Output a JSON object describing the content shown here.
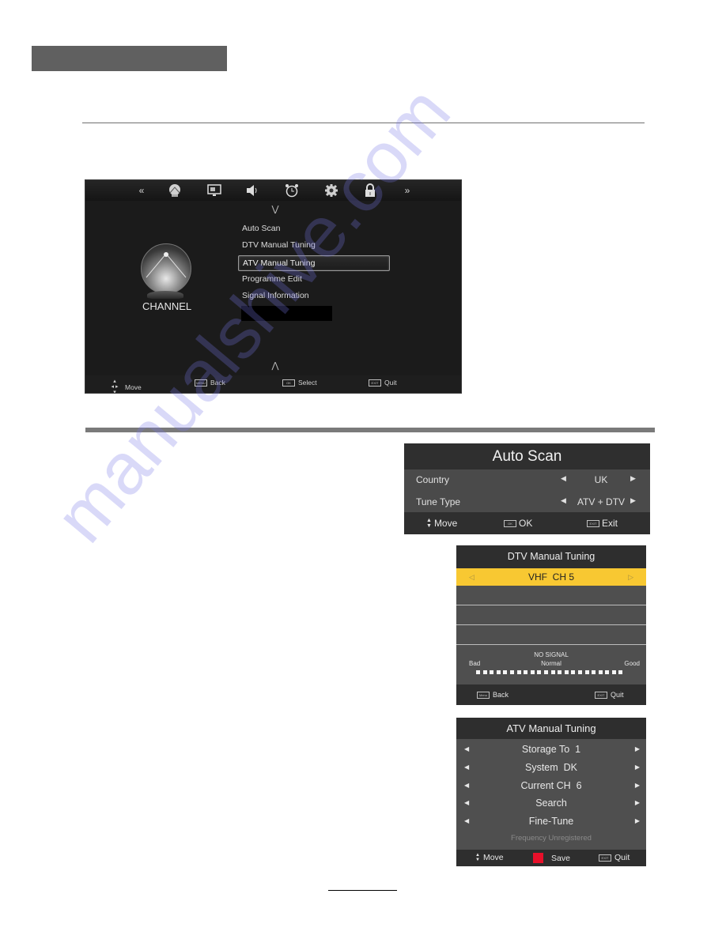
{
  "watermark": "manualshive.com",
  "main_menu": {
    "nav_icons": [
      "chevron-left-icon",
      "channel-icon",
      "picture-icon",
      "sound-icon",
      "clock-icon",
      "setup-icon",
      "lock-icon",
      "chevron-right-icon"
    ],
    "category_label": "CHANNEL",
    "items": [
      "Auto Scan",
      "DTV Manual Tuning",
      "ATV Manual Tuning",
      "Programme Edit",
      "Signal Information"
    ],
    "selected_index": 2,
    "footer": {
      "move": "Move",
      "menu_key": "MENU",
      "back": "Back",
      "ok_key": "OK",
      "select": "Select",
      "exit_key": "EXIT",
      "quit": "Quit"
    }
  },
  "auto_scan": {
    "title": "Auto Scan",
    "rows": [
      {
        "label": "Country",
        "value": "UK"
      },
      {
        "label": "Tune Type",
        "value": "ATV + DTV"
      }
    ],
    "footer": {
      "move": "Move",
      "ok_key": "OK",
      "ok": "OK",
      "exit_key": "EXIT",
      "exit": "Exit"
    }
  },
  "dtv_manual_tuning": {
    "title": "DTV Manual Tuning",
    "channel": "VHF  CH 5",
    "signal_status": "NO SIGNAL",
    "scale": {
      "low": "Bad",
      "mid": "Normal",
      "high": "Good"
    },
    "signal_segments": 22,
    "footer": {
      "menu_key": "Menu",
      "back": "Back",
      "exit_key": "EXIT",
      "quit": "Quit"
    }
  },
  "atv_manual_tuning": {
    "title": "ATV Manual Tuning",
    "rows": [
      "Storage To  1",
      "System  DK",
      "Current CH  6",
      "Search",
      "Fine-Tune"
    ],
    "frequency": "Frequency Unregistered",
    "footer": {
      "move": "Move",
      "save": "Save",
      "exit_key": "EXIT",
      "quit": "Quit"
    },
    "save_color": "#e8102a"
  },
  "colors": {
    "highlight": "#f8c832",
    "panel_dark": "#2e2e2e",
    "panel": "#4f4f4f",
    "menu_bg": "#1b1b1b"
  }
}
